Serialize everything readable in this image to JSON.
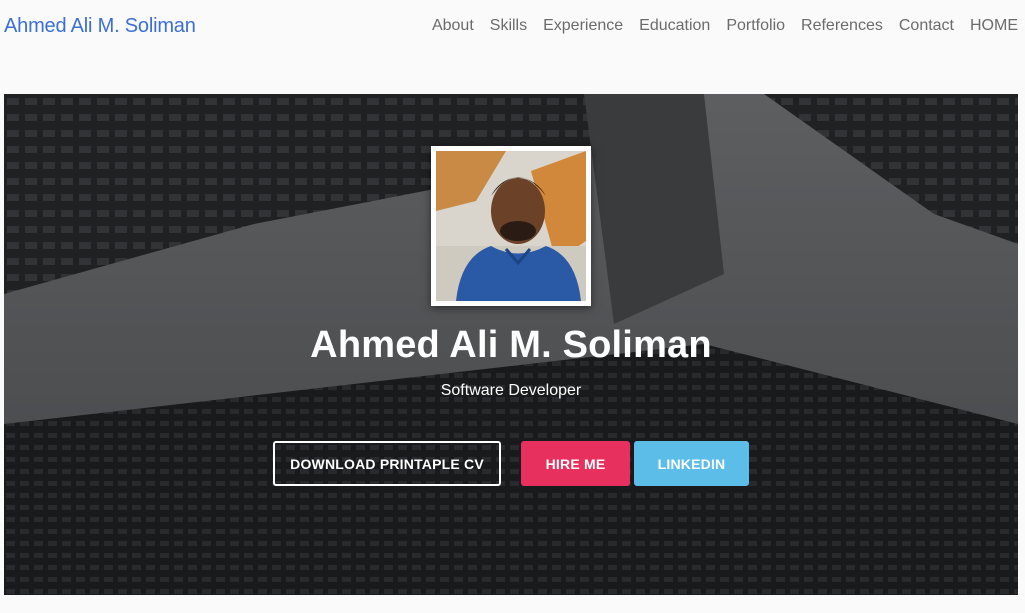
{
  "nav": {
    "brand": "Ahmed Ali M. Soliman",
    "links": [
      "About",
      "Skills",
      "Experience",
      "Education",
      "Portfolio",
      "References",
      "Contact",
      "HOME"
    ]
  },
  "hero": {
    "name": "Ahmed Ali M. Soliman",
    "role": "Software Developer",
    "buttons": {
      "cv": "DOWNLOAD PRINTAPLE CV",
      "hire": "HIRE ME",
      "linkedin": "LINKEDIN"
    }
  },
  "colors": {
    "brand": "#3b6fd4",
    "hire_button": "#e8305e",
    "linkedin_button": "#5bbde8",
    "nav_text": "#6b6b6b"
  }
}
